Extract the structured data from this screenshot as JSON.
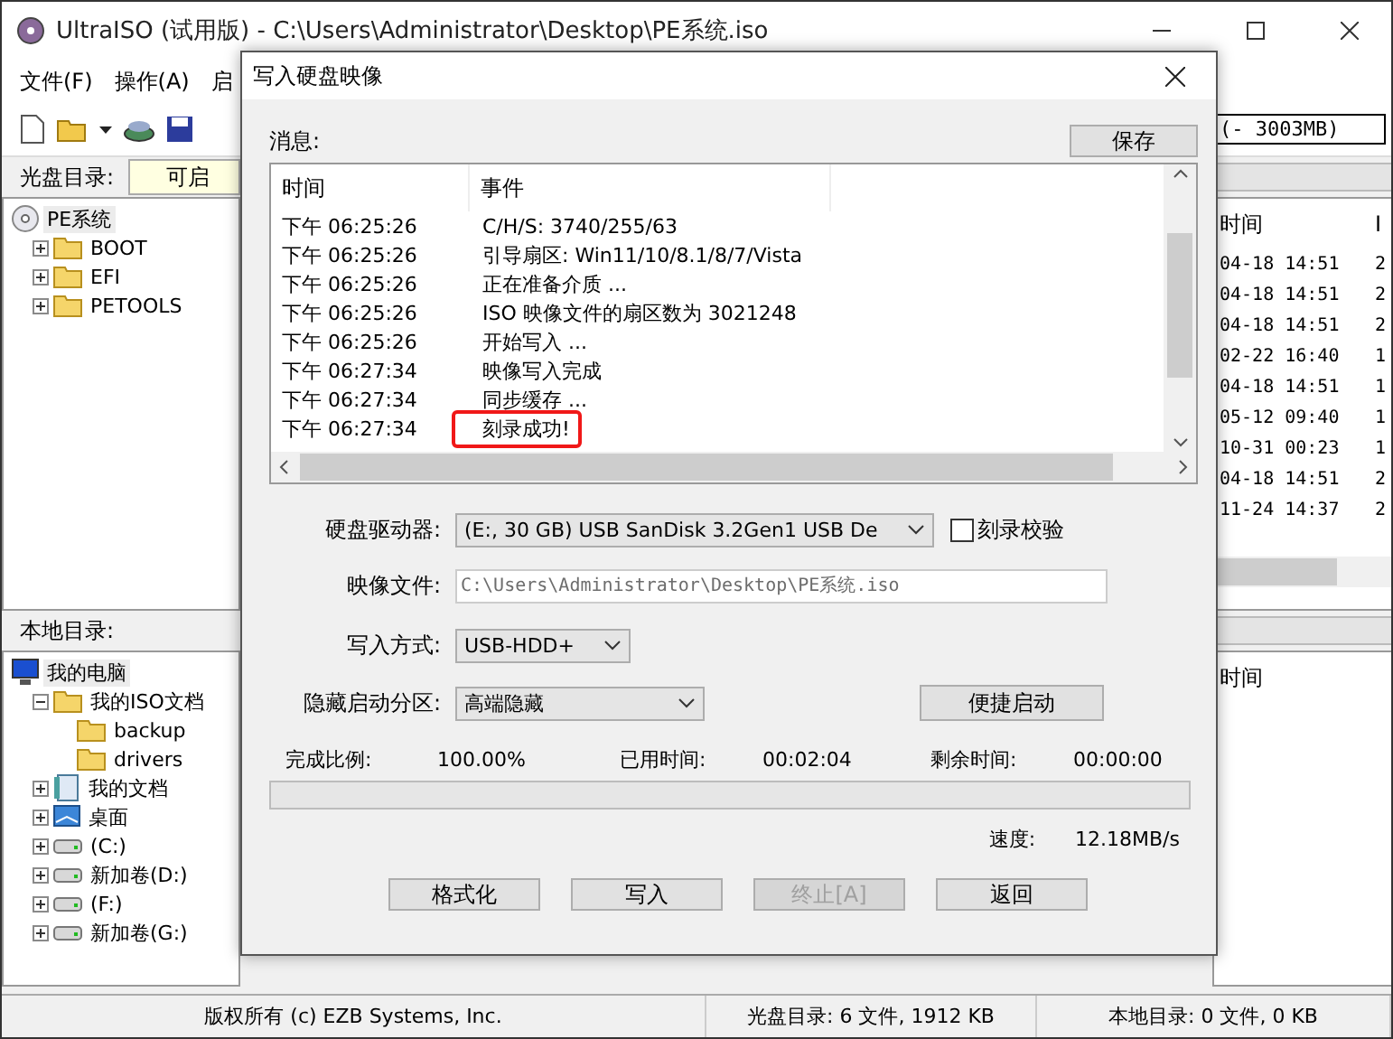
{
  "window": {
    "title": "UltraISO (试用版) - C:\\Users\\Administrator\\Desktop\\PE系统.iso"
  },
  "menu": [
    "文件(F)",
    "操作(A)",
    "启"
  ],
  "toolbar": {
    "size_readout": "(- 3003MB)"
  },
  "iso_path": {
    "label": "光盘目录:",
    "value": "可启"
  },
  "iso_tree": {
    "label": "PE系统",
    "kind": "disc",
    "selected": true,
    "children": [
      {
        "label": "BOOT",
        "kind": "folder",
        "expanded": false,
        "selected": false
      },
      {
        "label": "EFI",
        "kind": "folder",
        "expanded": false,
        "selected": false
      },
      {
        "label": "PETOOLS",
        "kind": "folder",
        "expanded": false,
        "selected": false
      }
    ]
  },
  "iso_files": {
    "columns": [
      "时间",
      "I"
    ],
    "rows": [
      [
        "04-18 14:51",
        "2"
      ],
      [
        "04-18 14:51",
        "2"
      ],
      [
        "04-18 14:51",
        "2"
      ],
      [
        "02-22 16:40",
        "1"
      ],
      [
        "04-18 14:51",
        "1"
      ],
      [
        "05-12 09:40",
        "1"
      ],
      [
        "10-31 00:23",
        "1"
      ],
      [
        "04-18 14:51",
        "2"
      ],
      [
        "11-24 14:37",
        "2"
      ]
    ]
  },
  "local_label": "本地目录:",
  "local_tree": {
    "label": "我的电脑",
    "kind": "computer",
    "selected": true,
    "children": [
      {
        "label": "我的ISO文档",
        "kind": "folder",
        "expanded": true,
        "selected": false,
        "children": [
          {
            "label": "backup",
            "kind": "folder",
            "selected": false
          },
          {
            "label": "drivers",
            "kind": "folder",
            "selected": false
          }
        ]
      },
      {
        "label": "我的文档",
        "kind": "documents",
        "expanded": false,
        "selected": false
      },
      {
        "label": "桌面",
        "kind": "desktop",
        "expanded": false,
        "selected": false
      },
      {
        "label": "(C:)",
        "kind": "drive",
        "expanded": false,
        "selected": false
      },
      {
        "label": "新加卷(D:)",
        "kind": "drive",
        "expanded": false,
        "selected": false
      },
      {
        "label": "(F:)",
        "kind": "drive",
        "expanded": false,
        "selected": false
      },
      {
        "label": "新加卷(G:)",
        "kind": "drive",
        "expanded": false,
        "selected": false
      }
    ]
  },
  "local_files": {
    "columns": [
      "时间"
    ]
  },
  "status_bar": [
    "版权所有 (c) EZB Systems, Inc.",
    "光盘目录: 6 文件, 1912 KB",
    "本地目录: 0 文件, 0 KB"
  ],
  "dialog": {
    "title": "写入硬盘映像",
    "messages_label": "消息:",
    "save_button": "保存",
    "log": {
      "columns": [
        "时间",
        "事件"
      ],
      "rows": [
        {
          "time": "下午 06:25:26",
          "event": "C/H/S: 3740/255/63",
          "highlighted": false
        },
        {
          "time": "下午 06:25:26",
          "event": "引导扇区: Win11/10/8.1/8/7/Vista",
          "highlighted": false
        },
        {
          "time": "下午 06:25:26",
          "event": "正在准备介质 ...",
          "highlighted": false
        },
        {
          "time": "下午 06:25:26",
          "event": "ISO 映像文件的扇区数为 3021248",
          "highlighted": false
        },
        {
          "time": "下午 06:25:26",
          "event": "开始写入 ...",
          "highlighted": false
        },
        {
          "time": "下午 06:27:34",
          "event": "映像写入完成",
          "highlighted": false
        },
        {
          "time": "下午 06:27:34",
          "event": "同步缓存 ...",
          "highlighted": false
        },
        {
          "time": "下午 06:27:34",
          "event": "刻录成功!",
          "highlighted": true
        }
      ]
    },
    "drive": {
      "label": "硬盘驱动器:",
      "value": "(E:, 30 GB) USB  SanDisk 3.2Gen1 USB De"
    },
    "verify": {
      "label": "刻录校验",
      "checked": false
    },
    "image_file": {
      "label": "映像文件:",
      "value": "C:\\Users\\Administrator\\Desktop\\PE系统.iso"
    },
    "write_method": {
      "label": "写入方式:",
      "value": "USB-HDD+"
    },
    "hide_partition": {
      "label": "隐藏启动分区:",
      "value": "高端隐藏"
    },
    "quick_boot_button": "便捷启动",
    "stats": [
      {
        "label": "完成比例:",
        "value": "100.00%"
      },
      {
        "label": "已用时间:",
        "value": "00:02:04"
      },
      {
        "label": "剩余时间:",
        "value": "00:00:00"
      }
    ],
    "progress": {
      "level": 0
    },
    "speed": {
      "label": "速度:",
      "value": "12.18MB/s"
    },
    "buttons": [
      {
        "label": "格式化",
        "disabled": false
      },
      {
        "label": "写入",
        "disabled": false
      },
      {
        "label": "终止[A]",
        "disabled": true
      },
      {
        "label": "返回",
        "disabled": false
      }
    ]
  }
}
